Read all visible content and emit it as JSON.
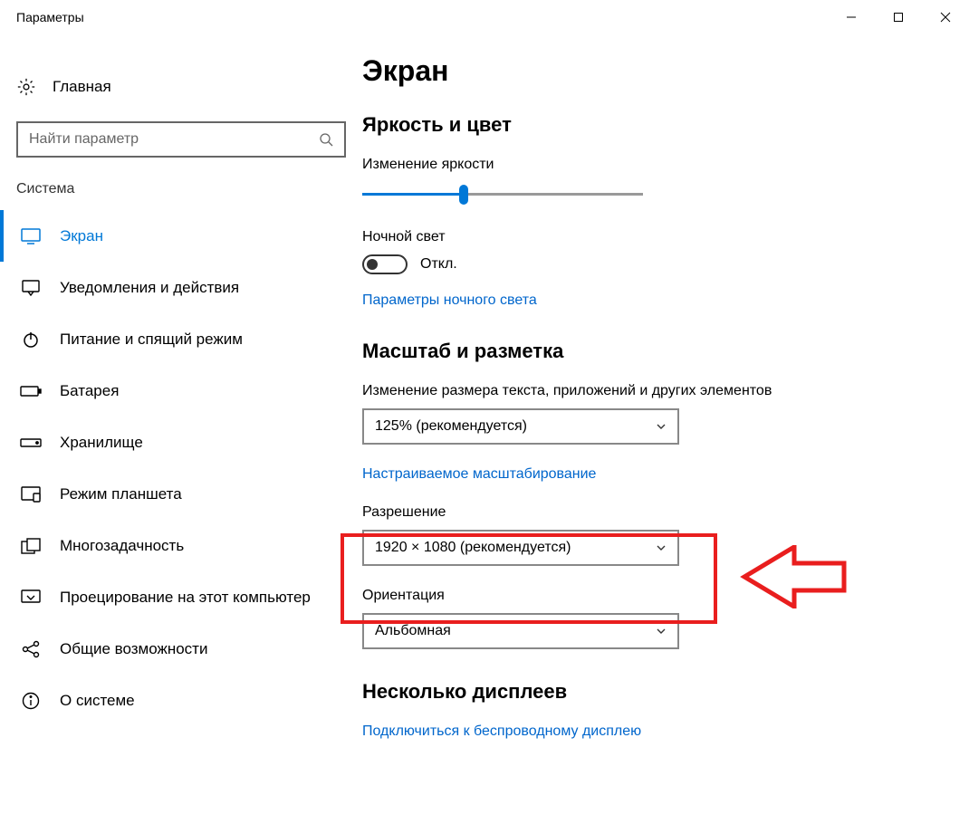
{
  "window": {
    "title": "Параметры"
  },
  "sidebar": {
    "home_label": "Главная",
    "search_placeholder": "Найти параметр",
    "category": "Система",
    "items": [
      {
        "label": "Экран"
      },
      {
        "label": "Уведомления и действия"
      },
      {
        "label": "Питание и спящий режим"
      },
      {
        "label": "Батарея"
      },
      {
        "label": "Хранилище"
      },
      {
        "label": "Режим планшета"
      },
      {
        "label": "Многозадачность"
      },
      {
        "label": "Проецирование на этот компьютер"
      },
      {
        "label": "Общие возможности"
      },
      {
        "label": "О системе"
      }
    ]
  },
  "main": {
    "title": "Экран",
    "brightness": {
      "heading": "Яркость и цвет",
      "brightness_label": "Изменение яркости",
      "nightlight_label": "Ночной свет",
      "toggle_state": "Откл.",
      "link": "Параметры ночного света"
    },
    "scale": {
      "heading": "Масштаб и разметка",
      "scale_label": "Изменение размера текста, приложений и других элементов",
      "scale_value": "125% (рекомендуется)",
      "custom_link": "Настраиваемое масштабирование",
      "resolution_label": "Разрешение",
      "resolution_value": "1920 × 1080 (рекомендуется)",
      "orientation_label": "Ориентация",
      "orientation_value": "Альбомная"
    },
    "multi": {
      "heading": "Несколько дисплеев",
      "link": "Подключиться к беспроводному дисплею"
    }
  }
}
